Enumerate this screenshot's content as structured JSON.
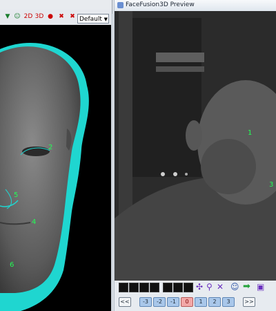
{
  "left": {
    "toolbar": {
      "icons": [
        "view-icon",
        "face-icon",
        "record-2d-icon",
        "record-3d-icon",
        "stop-icon",
        "delete-icon",
        "close-icon"
      ],
      "select_value": "Default"
    },
    "landmarks": [
      {
        "label": "2"
      },
      {
        "label": "5"
      },
      {
        "label": "4"
      },
      {
        "label": "6"
      }
    ]
  },
  "right": {
    "title": "FaceFusion3D Preview",
    "landmarks": [
      {
        "label": "1"
      },
      {
        "label": "3"
      }
    ],
    "frame_buttons": [
      "<<",
      "-3",
      "-2",
      "-1",
      "0",
      "1",
      "2",
      "3",
      ">>"
    ]
  },
  "colors": {
    "landmark_green": "#22ff55",
    "mesh_cyan": "#1fd6d0",
    "frame_negative": "#a9c7ea",
    "frame_zero": "#f2a8a8"
  }
}
